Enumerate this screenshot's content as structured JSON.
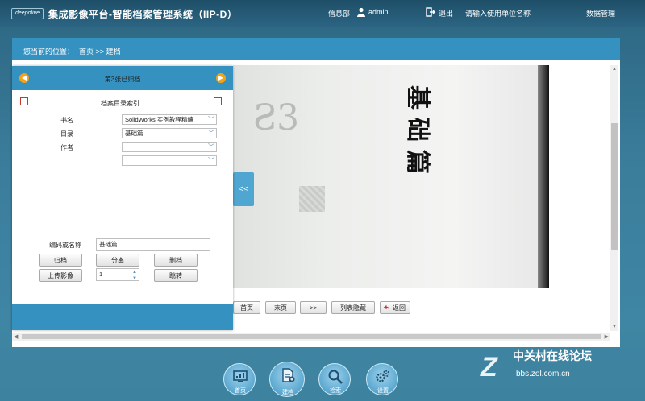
{
  "header": {
    "logo_text": "deepolive",
    "app_title": "集成影像平台-智能档案管理系统（IIP-D）",
    "dept": "信息部",
    "user": "admin",
    "logout": "退出",
    "unit_prompt": "请输入使用单位名称",
    "data_manage": "数据管理"
  },
  "breadcrumb": {
    "prefix": "您当前的位置：",
    "path": "首页 >> 建档"
  },
  "sidebar": {
    "title": "第3张已归档",
    "index_label": "档案目录索引",
    "fields": {
      "book_label": "书名",
      "book_value": "SolidWorks 实例教程精编",
      "catalog_label": "目录",
      "catalog_value": "基础篇",
      "author_label": "作者",
      "author_value": "",
      "extra_value": ""
    },
    "code_label": "编码或名称",
    "code_value": "基础篇",
    "buttons": {
      "archive": "归档",
      "split": "分离",
      "delete": "删档",
      "upload": "上传影像",
      "jump": "跳转"
    },
    "page_num": "1"
  },
  "collapse_label": "<<",
  "image": {
    "vertical_title": [
      "基",
      "础",
      "篇"
    ]
  },
  "nav": {
    "first": "首页",
    "last": "末页",
    "next": ">>",
    "toggle_list": "列表隐藏",
    "back": "返回"
  },
  "dock": [
    {
      "label": "首页",
      "icon": "monitor-chart-icon"
    },
    {
      "label": "建档",
      "icon": "document-add-icon"
    },
    {
      "label": "检索",
      "icon": "magnifier-icon"
    },
    {
      "label": "设置",
      "icon": "gears-icon"
    }
  ],
  "watermark": {
    "text": "中关村在线论坛",
    "url": "bbs.zol.com.cn"
  },
  "colors": {
    "accent": "#3592c0",
    "arrow": "#f3a21a"
  }
}
